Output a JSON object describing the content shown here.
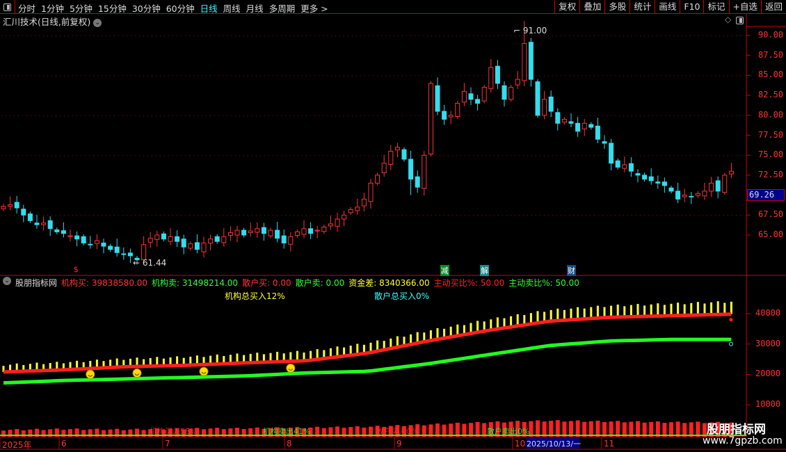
{
  "toolbar": {
    "periods": [
      "分时",
      "1分钟",
      "5分钟",
      "15分钟",
      "30分钟",
      "60分钟",
      "日线",
      "周线",
      "月线",
      "多周期",
      "更多 >"
    ],
    "active": "日线",
    "right_buttons": [
      "复权",
      "叠加",
      "多股",
      "统计",
      "画线",
      "F10",
      "标记",
      "+自选",
      "返回"
    ]
  },
  "chart": {
    "title": "汇川技术(日线,前复权)",
    "high_label": "91.00",
    "low_label": "61.44",
    "current_price": "69.26",
    "price_ticks": [
      "90.00",
      "87.50",
      "85.00",
      "82.50",
      "80.00",
      "77.50",
      "75.00",
      "72.50",
      "67.50",
      "65.00"
    ],
    "price_tick_values": [
      90,
      87.5,
      85,
      82.5,
      80,
      77.5,
      75,
      72.5,
      67.5,
      65
    ],
    "markers": [
      {
        "text": "$",
        "bar": 11,
        "color": "#f33"
      },
      {
        "text": "减",
        "bar": 66,
        "color": "#0a8a2a"
      },
      {
        "text": "解",
        "bar": 72,
        "color": "#178a8a"
      },
      {
        "text": "财",
        "bar": 85,
        "color": "#144c80"
      }
    ],
    "close": [
      68.6,
      68.8,
      68.4,
      67.5,
      66.8,
      66.3,
      66.5,
      65.8,
      65.4,
      65.2,
      64.9,
      64.5,
      64.0,
      63.8,
      64.3,
      63.6,
      63.2,
      62.8,
      62.6,
      62.4,
      61.9,
      63.8,
      64.6,
      65.0,
      64.5,
      64.8,
      64.2,
      63.5,
      63.9,
      63.2,
      64.0,
      64.5,
      64.2,
      64.8,
      65.3,
      65.6,
      65.0,
      65.5,
      65.8,
      65.2,
      65.6,
      64.6,
      64.0,
      64.8,
      65.4,
      65.8,
      65.2,
      65.6,
      66.0,
      66.4,
      67.0,
      67.5,
      68.2,
      68.5,
      69.5,
      71.5,
      72.5,
      74.0,
      75.5,
      76.0,
      74.5,
      72.0,
      71.0,
      75.0,
      84.0,
      80.5,
      79.5,
      80.0,
      81.5,
      83.0,
      82.0,
      81.5,
      83.5,
      86.0,
      84.0,
      82.0,
      83.5,
      84.5,
      89.0,
      84.5,
      80.0,
      82.0,
      80.5,
      79.0,
      79.5,
      79.0,
      78.0,
      79.0,
      78.5,
      77.0,
      76.5,
      74.0,
      73.5,
      73.8,
      73.0,
      72.5,
      72.0,
      71.8,
      71.5,
      71.2,
      70.5,
      69.5,
      70.0,
      69.8,
      70.2,
      70.5,
      71.5,
      70.5,
      72.5,
      73.0
    ]
  },
  "indicator": {
    "name": "股朋指标网",
    "values": [
      {
        "label": "机构买: 39838580.00",
        "color": "#f33"
      },
      {
        "label": "机构卖: 31498214.00",
        "color": "#3f3"
      },
      {
        "label": "散户买: 0.00",
        "color": "#f33"
      },
      {
        "label": "散户卖: 0.00",
        "color": "#3f3"
      },
      {
        "label": "资金差: 8340366.00",
        "color": "#ff3"
      },
      {
        "label": "主动买比%: 50.00",
        "color": "#f22"
      },
      {
        "label": "主动卖比%: 50.00",
        "color": "#3f3"
      }
    ],
    "inst_total_buy": "机构总买入12%",
    "retail_total_buy": "散户总买入0%",
    "bottom_labels": [
      "机构买入58%",
      "机构卖出41%",
      "散户买入0%",
      "散户卖出0%"
    ],
    "ticks": [
      "40000",
      "30000",
      "20000",
      "10000"
    ],
    "tick_values": [
      40000,
      30000,
      20000,
      10000
    ],
    "inst_buy_curve": [
      20800,
      21500,
      22500,
      23000,
      23800,
      24500,
      27000,
      31000,
      34500,
      37500,
      38800,
      39300,
      39838
    ],
    "inst_sell_curve": [
      17200,
      18000,
      18500,
      19000,
      19500,
      20500,
      21000,
      23500,
      26500,
      29500,
      31000,
      31500,
      31498
    ],
    "smiley_bars": [
      13,
      20,
      30,
      43
    ],
    "histogram": [
      40,
      45,
      42,
      48,
      50,
      55,
      60,
      75,
      90,
      100,
      95,
      90,
      88
    ],
    "colors": {
      "buy": "#ff2020",
      "sell": "#20ff20",
      "bar": "#ffff30"
    }
  },
  "time_axis": {
    "labels": [
      "2025年",
      "6",
      "7",
      "8",
      "9",
      "10",
      "11"
    ],
    "cursor": "2025/10/13/一"
  },
  "watermark": {
    "name": "股朋指标网",
    "url": "www.7gpzb.com"
  }
}
